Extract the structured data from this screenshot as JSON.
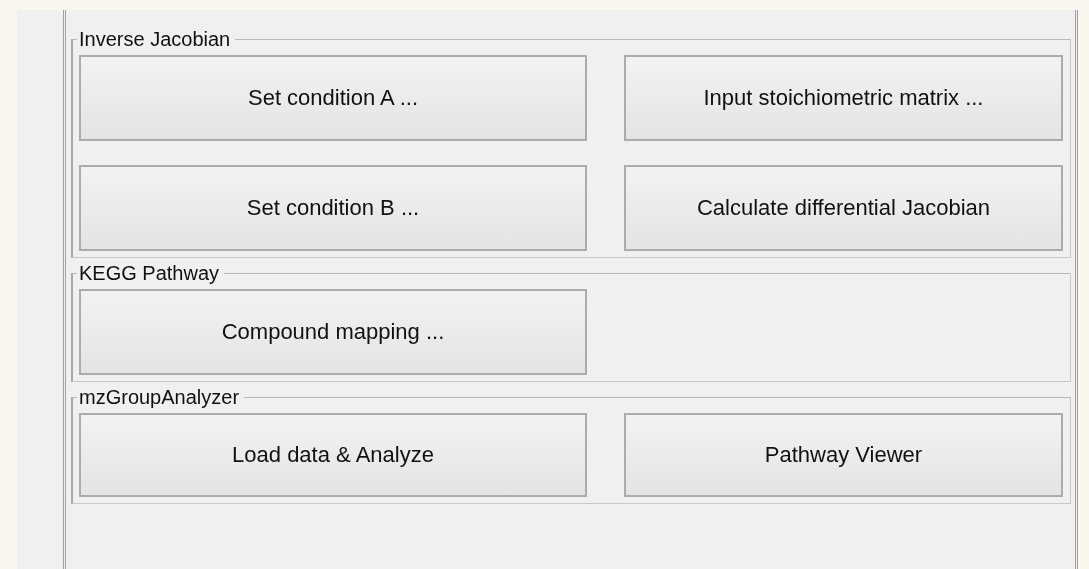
{
  "groups": [
    {
      "title": "Inverse Jacobian",
      "buttons": [
        "Set condition A ...",
        "Input stoichiometric matrix ...",
        "Set condition B ...",
        "Calculate differential Jacobian"
      ]
    },
    {
      "title": "KEGG Pathway",
      "buttons": [
        "Compound mapping ..."
      ]
    },
    {
      "title": "mzGroupAnalyzer",
      "buttons": [
        "Load data & Analyze",
        "Pathway Viewer"
      ]
    }
  ]
}
